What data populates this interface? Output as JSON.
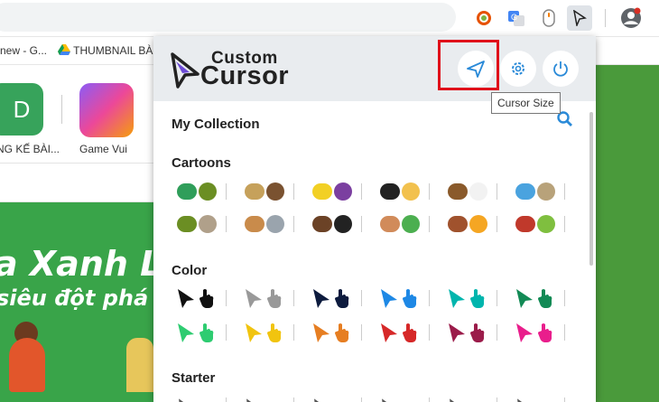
{
  "browser": {
    "bookmarks": [
      {
        "label": "new - G..."
      },
      {
        "label": "THUMBNAIL BÀI"
      }
    ]
  },
  "page": {
    "tiles": [
      {
        "letter": "D",
        "label": "NG KẾ BÀI..."
      },
      {
        "label": "Game Vui"
      }
    ],
    "banner": {
      "line1": "a Xanh Lá",
      "line2": "siêu đột phá"
    }
  },
  "popup": {
    "logo": {
      "word1": "Custom",
      "word2": "Cursor"
    },
    "tooltip": "Cursor Size",
    "sections": {
      "my_collection": "My Collection",
      "cartoons": "Cartoons",
      "color": "Color",
      "starter": "Starter"
    },
    "colors": {
      "row1": [
        "#111111",
        "#999999",
        "#0d1b3e",
        "#1e88e5",
        "#00b5ad",
        "#128a55"
      ],
      "row2": [
        "#2ecc71",
        "#f1c40f",
        "#e67e22",
        "#d62828",
        "#9b1c4a",
        "#e91e8c"
      ]
    },
    "cartoon_colors": {
      "row1": [
        [
          "#2f9e5a",
          "#6b8e23"
        ],
        [
          "#c6a15b",
          "#7a5230"
        ],
        [
          "#f2d024",
          "#7b3fa0"
        ],
        [
          "#222222",
          "#f2c14e"
        ],
        [
          "#8a5a2b",
          "#f2f2f2"
        ],
        [
          "#4aa3df",
          "#b8a27a"
        ]
      ],
      "row2": [
        [
          "#6b8e23",
          "#b0a08a"
        ],
        [
          "#c98b4b",
          "#9aa4ad"
        ],
        [
          "#6b4226",
          "#222222"
        ],
        [
          "#d18b5a",
          "#4caf50"
        ],
        [
          "#a0522d",
          "#f5a623"
        ],
        [
          "#c0392b",
          "#7fbf3f"
        ]
      ]
    }
  }
}
